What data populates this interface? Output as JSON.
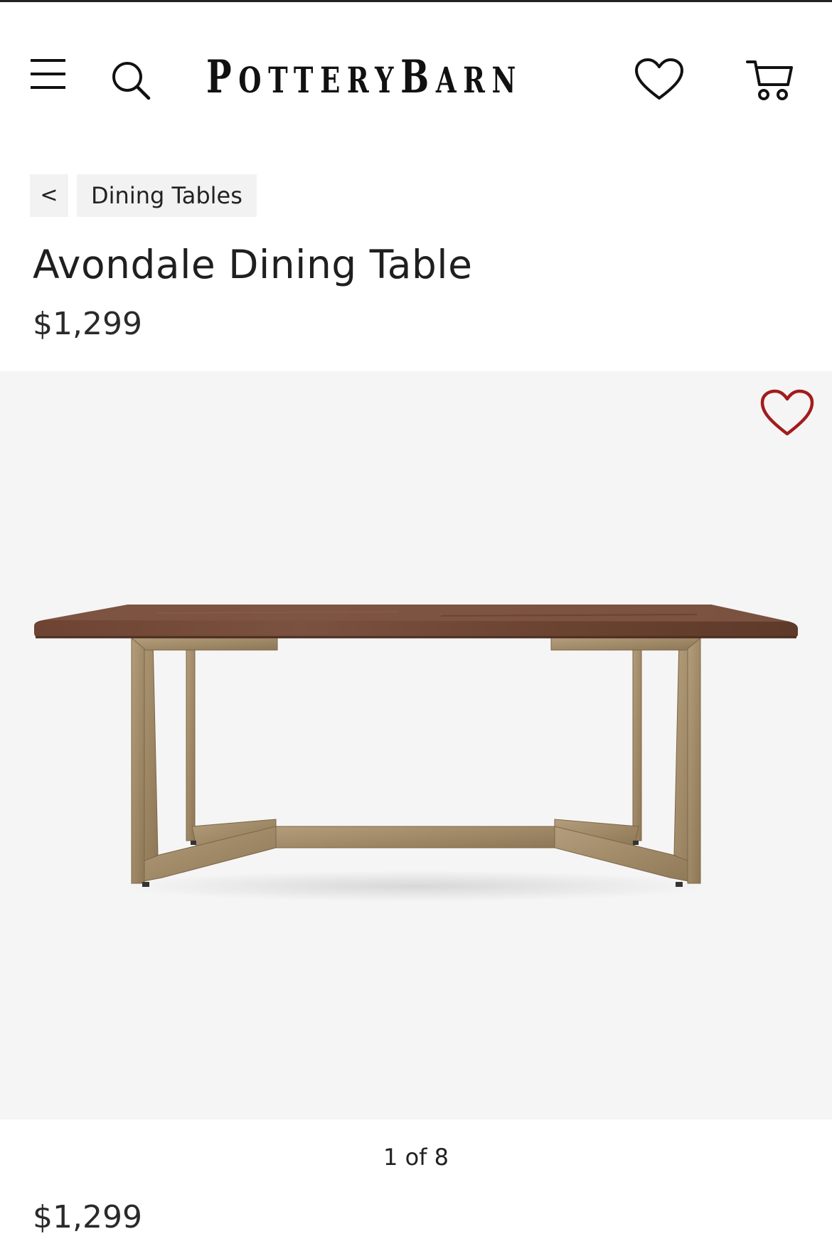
{
  "header": {
    "logo": "POTTERYBARN",
    "icons": {
      "menu": "hamburger-menu-icon",
      "search": "search-icon",
      "wishlist": "heart-icon",
      "cart": "cart-icon"
    }
  },
  "breadcrumb": {
    "back_label": "<",
    "link_label": "Dining Tables"
  },
  "product": {
    "title": "Avondale Dining Table",
    "price": "$1,299"
  },
  "carousel": {
    "favorite_icon": "heart-outline-icon",
    "favorite_color": "#a31c1c",
    "pager_label": "1 of 8"
  },
  "bottom": {
    "price": "$1,299"
  }
}
